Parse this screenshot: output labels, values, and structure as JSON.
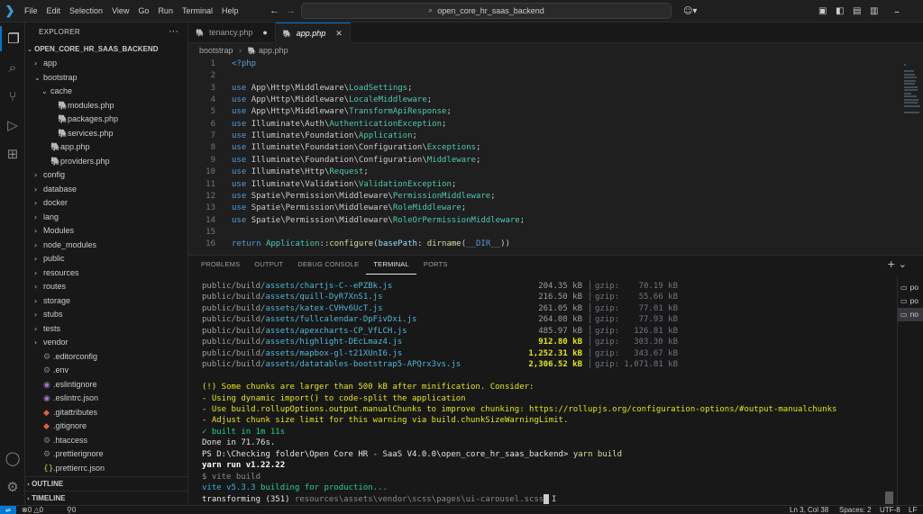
{
  "titlebar": {
    "menus": [
      "File",
      "Edit",
      "Selection",
      "View",
      "Go",
      "Run",
      "Terminal",
      "Help"
    ],
    "search_text": "open_core_hr_saas_backend"
  },
  "explorer": {
    "title": "EXPLORER",
    "root": "OPEN_CORE_HR_SAAS_BACKEND",
    "items": [
      {
        "label": "app",
        "type": "folder",
        "open": false,
        "depth": 0
      },
      {
        "label": "bootstrap",
        "type": "folder",
        "open": true,
        "depth": 0
      },
      {
        "label": "cache",
        "type": "folder",
        "open": true,
        "depth": 1
      },
      {
        "label": "modules.php",
        "type": "php",
        "depth": 2
      },
      {
        "label": "packages.php",
        "type": "php",
        "depth": 2
      },
      {
        "label": "services.php",
        "type": "php",
        "depth": 2
      },
      {
        "label": "app.php",
        "type": "php",
        "depth": 1
      },
      {
        "label": "providers.php",
        "type": "php",
        "depth": 1
      },
      {
        "label": "config",
        "type": "folder",
        "open": false,
        "depth": 0
      },
      {
        "label": "database",
        "type": "folder",
        "open": false,
        "depth": 0
      },
      {
        "label": "docker",
        "type": "folder",
        "open": false,
        "depth": 0
      },
      {
        "label": "lang",
        "type": "folder",
        "open": false,
        "depth": 0
      },
      {
        "label": "Modules",
        "type": "folder",
        "open": false,
        "depth": 0
      },
      {
        "label": "node_modules",
        "type": "folder",
        "open": false,
        "depth": 0
      },
      {
        "label": "public",
        "type": "folder",
        "open": false,
        "depth": 0
      },
      {
        "label": "resources",
        "type": "folder",
        "open": false,
        "depth": 0
      },
      {
        "label": "routes",
        "type": "folder",
        "open": false,
        "depth": 0
      },
      {
        "label": "storage",
        "type": "folder",
        "open": false,
        "depth": 0
      },
      {
        "label": "stubs",
        "type": "folder",
        "open": false,
        "depth": 0
      },
      {
        "label": "tests",
        "type": "folder",
        "open": false,
        "depth": 0
      },
      {
        "label": "vendor",
        "type": "folder",
        "open": false,
        "depth": 0
      },
      {
        "label": ".editorconfig",
        "type": "gear",
        "depth": 0
      },
      {
        "label": ".env",
        "type": "gear",
        "depth": 0
      },
      {
        "label": ".eslintignore",
        "type": "eslint",
        "depth": 0
      },
      {
        "label": ".eslintrc.json",
        "type": "eslint",
        "depth": 0
      },
      {
        "label": ".gitattributes",
        "type": "git",
        "depth": 0
      },
      {
        "label": ".gitignore",
        "type": "git",
        "depth": 0
      },
      {
        "label": ".htaccess",
        "type": "gear",
        "depth": 0
      },
      {
        "label": ".prettierignore",
        "type": "gear",
        "depth": 0
      },
      {
        "label": ".prettierrc.json",
        "type": "json",
        "depth": 0
      }
    ],
    "outline": "OUTLINE",
    "timeline": "TIMELINE"
  },
  "editor": {
    "tabs": [
      {
        "label": "tenancy.php",
        "active": false,
        "modified": true
      },
      {
        "label": "app.php",
        "active": true,
        "modified": false
      }
    ],
    "breadcrumb": [
      "bootstrap",
      "app.php"
    ],
    "lines": [
      {
        "n": "1",
        "text": "<?php"
      },
      {
        "n": "2",
        "text": ""
      },
      {
        "n": "3",
        "text": "use App\\Http\\Middleware\\LoadSettings;"
      },
      {
        "n": "4",
        "text": "use App\\Http\\Middleware\\LocaleMiddleware;"
      },
      {
        "n": "5",
        "text": "use App\\Http\\Middleware\\TransformApiResponse;"
      },
      {
        "n": "6",
        "text": "use Illuminate\\Auth\\AuthenticationException;"
      },
      {
        "n": "7",
        "text": "use Illuminate\\Foundation\\Application;"
      },
      {
        "n": "8",
        "text": "use Illuminate\\Foundation\\Configuration\\Exceptions;"
      },
      {
        "n": "9",
        "text": "use Illuminate\\Foundation\\Configuration\\Middleware;"
      },
      {
        "n": "10",
        "text": "use Illuminate\\Http\\Request;"
      },
      {
        "n": "11",
        "text": "use Illuminate\\Validation\\ValidationException;"
      },
      {
        "n": "12",
        "text": "use Spatie\\Permission\\Middleware\\PermissionMiddleware;"
      },
      {
        "n": "13",
        "text": "use Spatie\\Permission\\Middleware\\RoleMiddleware;"
      },
      {
        "n": "14",
        "text": "use Spatie\\Permission\\Middleware\\RoleOrPermissionMiddleware;"
      },
      {
        "n": "15",
        "text": ""
      },
      {
        "n": "16",
        "text": "return Application::configure(basePath: dirname(__DIR__))"
      }
    ]
  },
  "panel": {
    "tabs": [
      "PROBLEMS",
      "OUTPUT",
      "DEBUG CONSOLE",
      "TERMINAL",
      "PORTS"
    ],
    "active_tab": "TERMINAL",
    "assets": [
      {
        "dir": "public/build/",
        "file": "assets/chartjs-C--ePZBk.js",
        "size": "204.35 kB",
        "gzip": "70.19 kB",
        "warn": false
      },
      {
        "dir": "public/build/",
        "file": "assets/quill-DyR7XnS1.js",
        "size": "216.50 kB",
        "gzip": "55.66 kB",
        "warn": false
      },
      {
        "dir": "public/build/",
        "file": "assets/katex-CVHv6UcT.js",
        "size": "261.05 kB",
        "gzip": "77.01 kB",
        "warn": false
      },
      {
        "dir": "public/build/",
        "file": "assets/fullcalendar-DpFivDxi.js",
        "size": "264.08 kB",
        "gzip": "77.93 kB",
        "warn": false
      },
      {
        "dir": "public/build/",
        "file": "assets/apexcharts-CP_VfLCH.js",
        "size": "485.97 kB",
        "gzip": "126.81 kB",
        "warn": false
      },
      {
        "dir": "public/build/",
        "file": "assets/highlight-DEcLmaz4.js",
        "size": "912.80 kB",
        "gzip": "303.30 kB",
        "warn": true
      },
      {
        "dir": "public/build/",
        "file": "assets/mapbox-gl-t21XUnI6.js",
        "size": "1,252.31 kB",
        "gzip": "343.67 kB",
        "warn": true
      },
      {
        "dir": "public/build/",
        "file": "assets/datatables-bootstrap5-APQrx3vs.js",
        "size": "2,306.52 kB",
        "gzip": "1,071.81 kB",
        "warn": true
      }
    ],
    "gzip_label": "gzip:",
    "warning_lines": [
      "(!) Some chunks are larger than 500 kB after minification. Consider:",
      "- Using dynamic import() to code-split the application",
      "- Use build.rollupOptions.output.manualChunks to improve chunking: https://rollupjs.org/configuration-options/#output-manualchunks",
      "- Adjust chunk size limit for this warning via build.chunkSizeWarningLimit."
    ],
    "built_line": "✓ built in 1m 11s",
    "done_line": "Done in 71.76s.",
    "prompt": "PS D:\\Checking folder\\Open Core HR - SaaS V4.0.0\\open_core_hr_saas_backend>",
    "command": "yarn build",
    "yarn_run": "yarn run v1.22.22",
    "vite_cmd": "$ vite build",
    "vite_version": "vite v5.3.3",
    "vite_building": "building for production...",
    "transforming_label": "transforming (351)",
    "transforming_path": "resources\\assets\\vendor\\scss\\pages\\ui-carousel.scss",
    "terminal_list": [
      "po",
      "po",
      "no"
    ]
  },
  "status": {
    "errors": "0",
    "warnings": "0",
    "ports": "0",
    "position": "Ln 3, Col 38",
    "spaces": "Spaces: 2",
    "encoding": "UTF-8",
    "eol": "LF"
  }
}
